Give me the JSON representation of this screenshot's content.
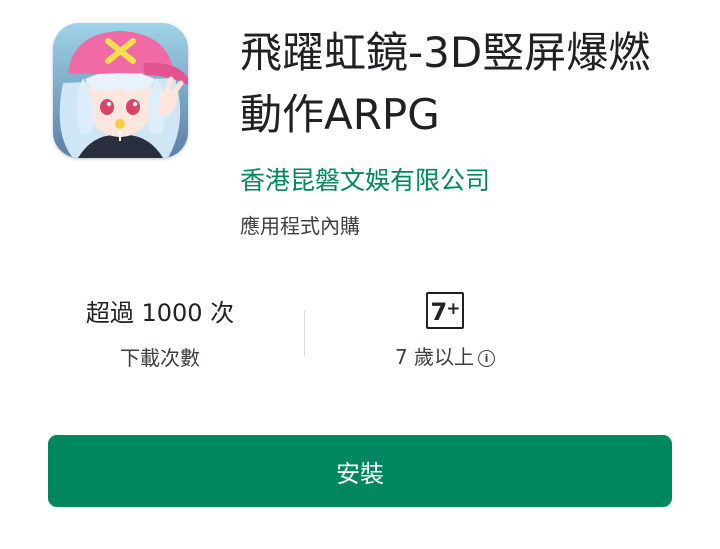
{
  "app": {
    "icon_name": "app-icon-anime-girl",
    "title": "飛躍虹鏡-3D竪屏爆燃動作ARPG",
    "developer": "香港昆磐文娛有限公司",
    "in_app_purchases": "應用程式內購"
  },
  "stats": {
    "downloads_value": "超過 1000 次",
    "downloads_label": "下載次數",
    "rating_badge_main": "7",
    "rating_badge_plus": "+",
    "rating_label": "7 歲以上",
    "info_icon": "info-icon"
  },
  "actions": {
    "install_label": "安裝"
  },
  "colors": {
    "accent": "#01875f",
    "text_primary": "#202124",
    "text_secondary": "#3c4043",
    "divider": "#dadce0",
    "button_text": "#ffffff"
  }
}
